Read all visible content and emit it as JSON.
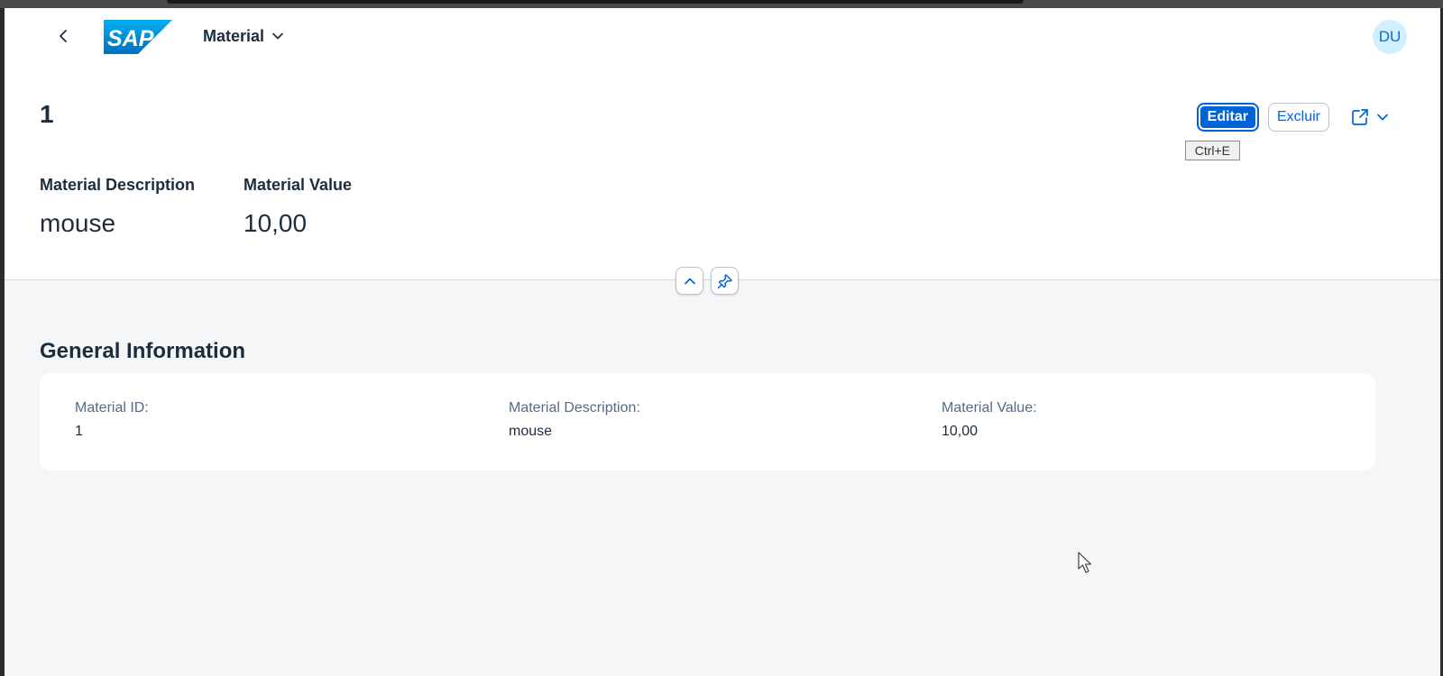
{
  "shell": {
    "app_title": "Material",
    "avatar_initials": "DU",
    "logo_text": "SAP"
  },
  "header": {
    "title": "1",
    "actions": {
      "edit_label": "Editar",
      "delete_label": "Excluir",
      "edit_tooltip": "Ctrl+E"
    },
    "kpis": [
      {
        "label": "Material Description",
        "value": "mouse"
      },
      {
        "label": "Material Value",
        "value": "10,00"
      }
    ]
  },
  "section": {
    "title": "General Information",
    "fields": [
      {
        "label": "Material ID:",
        "value": "1"
      },
      {
        "label": "Material Description:",
        "value": "mouse"
      },
      {
        "label": "Material Value:",
        "value": "10,00"
      }
    ]
  },
  "icons": {
    "back": "chevron-left-icon",
    "title_menu": "chevron-down-icon",
    "share": "share-icon",
    "share_menu": "chevron-down-icon",
    "collapse_header": "chevron-up-icon",
    "pin_header": "pin-icon"
  },
  "colors": {
    "brand": "#0064d9",
    "avatar_bg": "#d1efff",
    "page_bg": "#f5f6f7",
    "label": "#556b82"
  }
}
